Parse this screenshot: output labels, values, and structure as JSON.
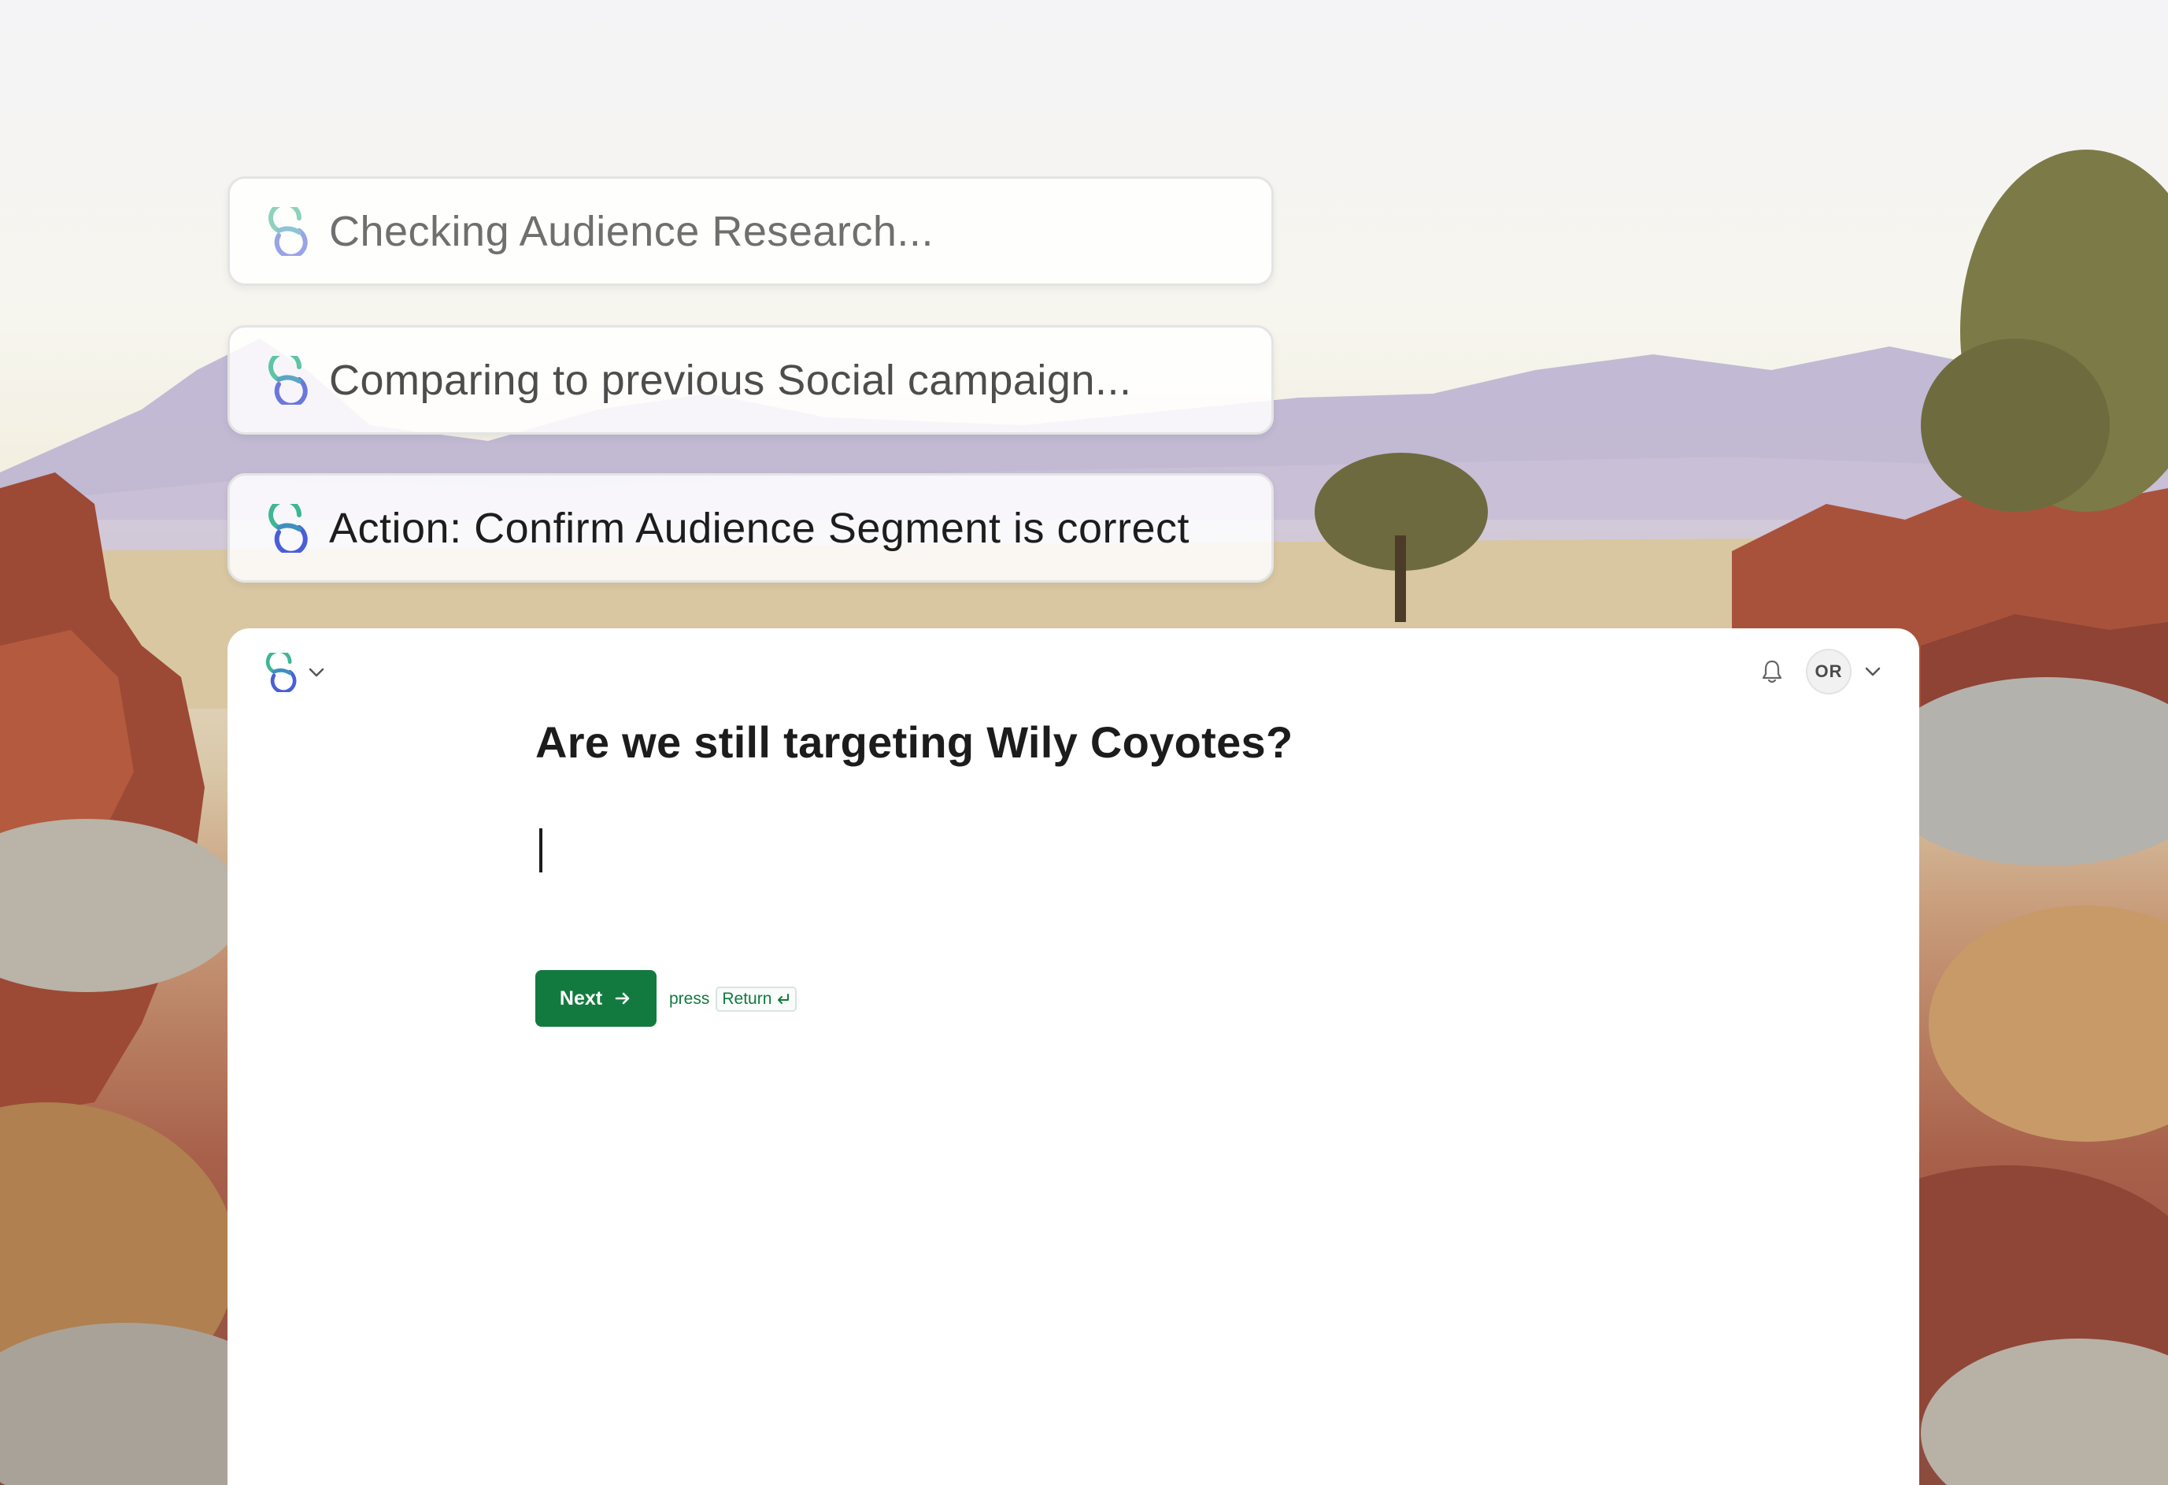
{
  "status_cards": [
    {
      "text": "Checking Audience Research..."
    },
    {
      "text": "Comparing to previous Social campaign..."
    },
    {
      "text": "Action: Confirm Audience Segment is correct"
    }
  ],
  "header": {
    "logo_icon": "brand-logo-icon",
    "workspace_menu_icon": "chevron-down-icon",
    "notifications_icon": "bell-icon",
    "avatar_initials": "OR",
    "user_menu_icon": "chevron-down-icon"
  },
  "form": {
    "question": "Are we still targeting Wily Coyotes?",
    "answer_value": "",
    "next_label": "Next",
    "next_icon": "arrow-right-icon",
    "hint_prefix": "press",
    "hint_key": "Return",
    "hint_key_icon": "return-key-icon"
  },
  "colors": {
    "accent": "#137a3f",
    "panel": "#ffffff",
    "logo_teal": "#5ec4a6",
    "logo_blue": "#4a5fd6"
  }
}
